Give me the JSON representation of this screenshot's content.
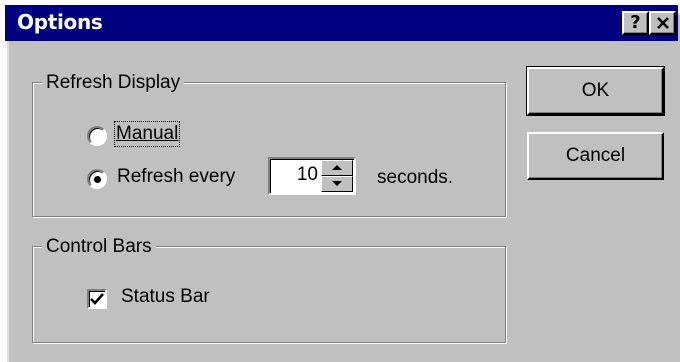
{
  "window": {
    "title": "Options",
    "help_glyph": "?",
    "close_glyph": "✕"
  },
  "refresh_group": {
    "legend": "Refresh Display",
    "manual_label": "Manual",
    "manual_selected": false,
    "refresh_label": "Refresh every",
    "refresh_selected": true,
    "interval_value": "10",
    "seconds_label": "seconds."
  },
  "control_group": {
    "legend": "Control Bars",
    "status_bar_label": "Status Bar",
    "status_bar_checked": true
  },
  "buttons": {
    "ok_label": "OK",
    "cancel_label": "Cancel"
  },
  "icons": {
    "help": "help-icon",
    "close": "close-icon",
    "spin_up": "spin-up-arrow-icon",
    "spin_down": "spin-down-arrow-icon",
    "check": "checkmark-icon"
  },
  "colors": {
    "titlebar": "#000080",
    "face": "#c0c0c0"
  }
}
